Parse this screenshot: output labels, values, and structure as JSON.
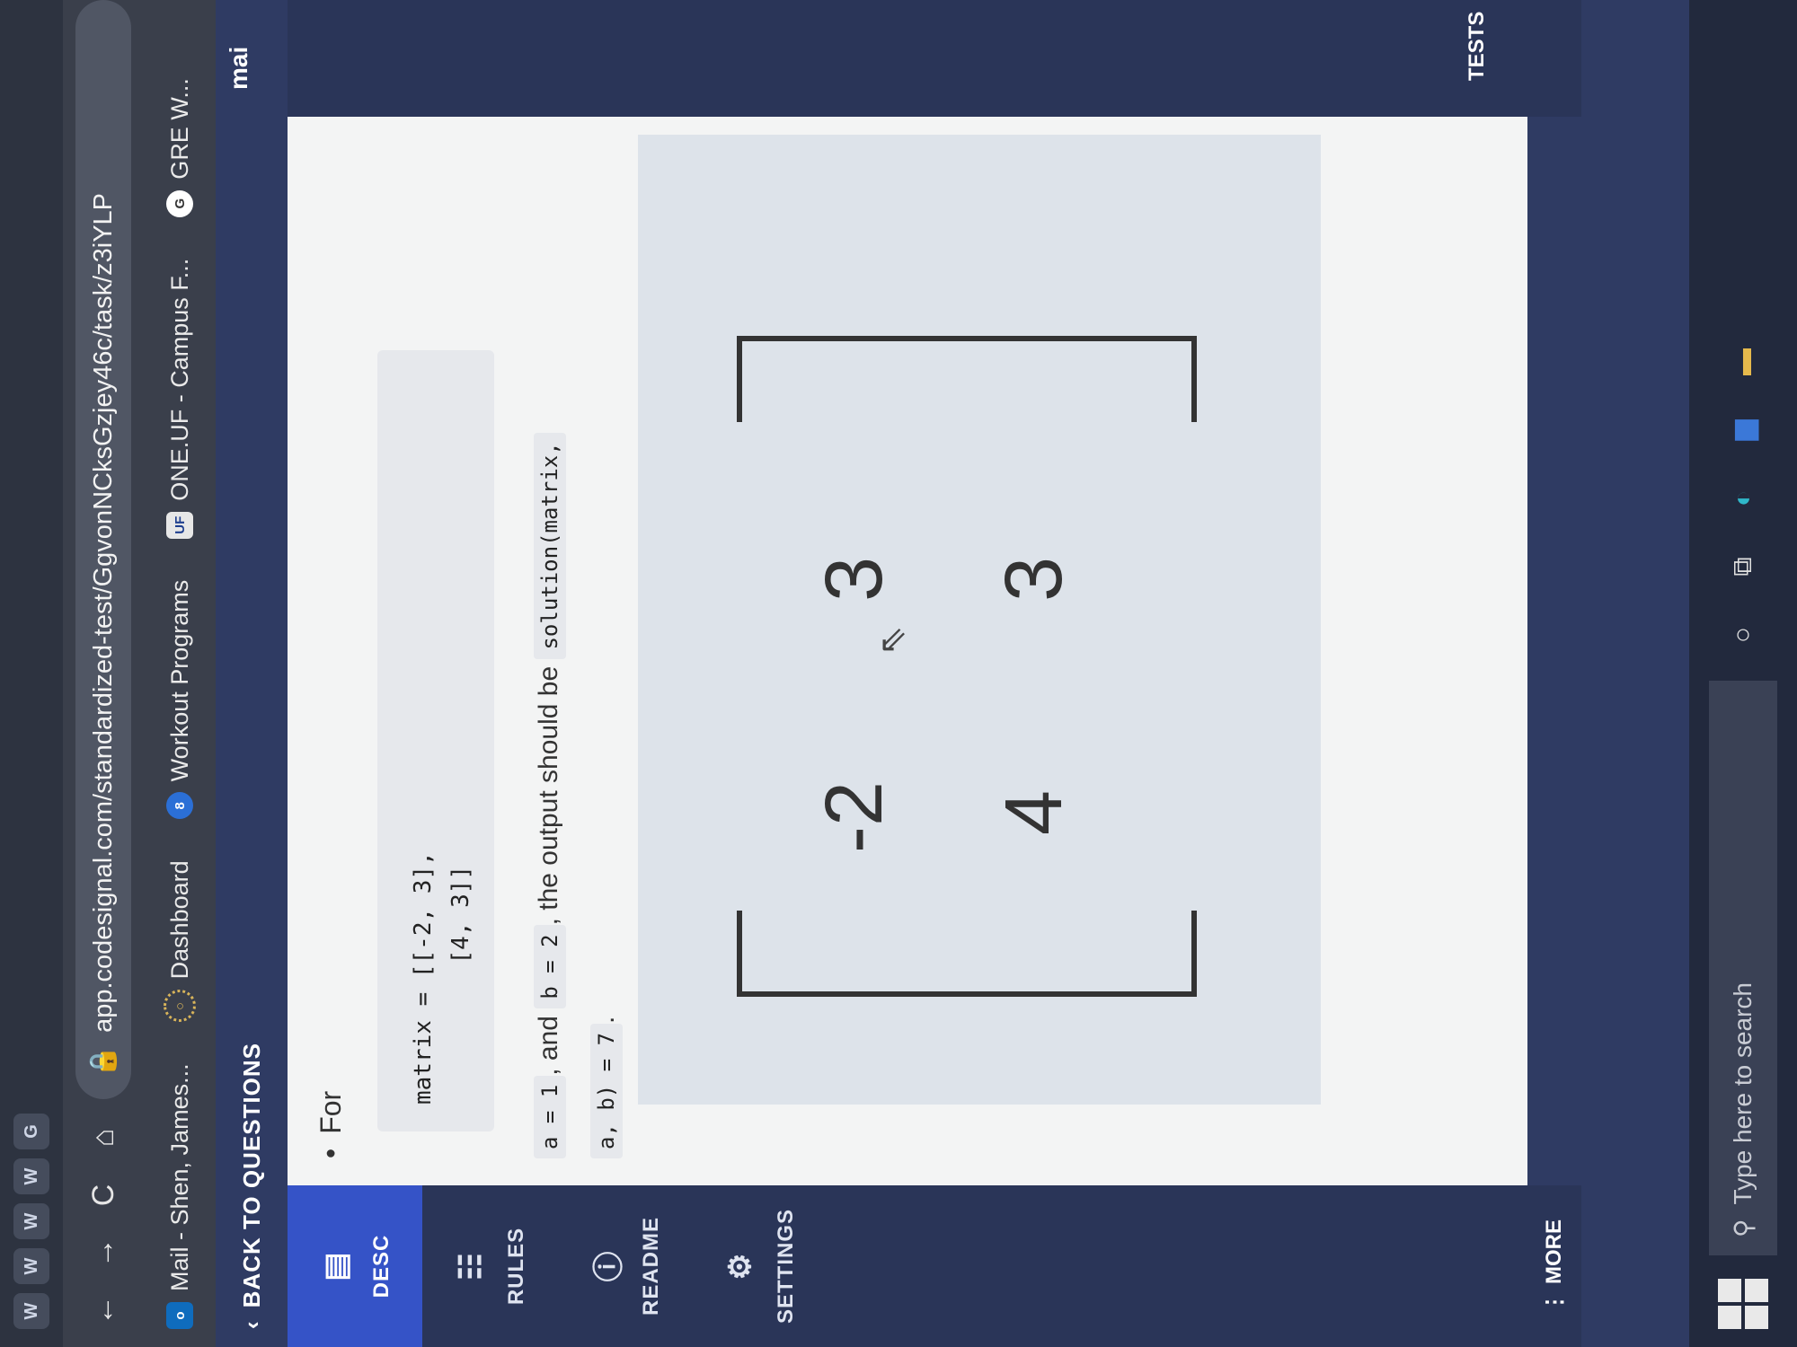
{
  "browser": {
    "tab_icons": [
      "W",
      "W",
      "W",
      "W",
      "G"
    ],
    "nav": {
      "back": "←",
      "forward": "→",
      "reload": "C",
      "home": "⌂"
    },
    "url": "app.codesignal.com/standardized-test/GgvonNCksGzjey46c/task/z3iYLP",
    "bookmarks": [
      {
        "label": "Mail - Shen, James...",
        "icon_text": "o",
        "color": "#0f6cbd"
      },
      {
        "label": "Dashboard",
        "icon_text": "○",
        "color": "#b58b3a"
      },
      {
        "label": "Workout Programs",
        "icon_text": "8",
        "color": "#2b6fd6"
      },
      {
        "label": "ONE.UF - Campus F...",
        "icon_text": "UF",
        "color": "#e7e7e7"
      },
      {
        "label": "GRE W...",
        "icon_text": "G",
        "color": "#ffffff"
      }
    ]
  },
  "app": {
    "back_label": "BACK TO QUESTIONS",
    "sidebar": [
      {
        "label": "DESC",
        "icon": "document-icon"
      },
      {
        "label": "RULES",
        "icon": "list-icon"
      },
      {
        "label": "README",
        "icon": "info-icon"
      },
      {
        "label": "SETTINGS",
        "icon": "gear-icon"
      }
    ],
    "more_label": "MORE",
    "main_label": "mai",
    "tests_label": "TESTS",
    "desc": {
      "bullet": "For",
      "code_line1": "matrix = [[-2, 3],",
      "code_line2": "          [4, 3]]",
      "a_code": "a = 1",
      "and_text": ", and",
      "b_code": "b = 2",
      "output_text": ", the output should be",
      "solution_code": "solution(matrix,",
      "result_code": "a, b) = 7",
      "period": "."
    },
    "matrix_image": {
      "values": [
        "-2",
        "3",
        "4",
        "3"
      ]
    }
  },
  "taskbar": {
    "search_placeholder": "Type here to search"
  }
}
